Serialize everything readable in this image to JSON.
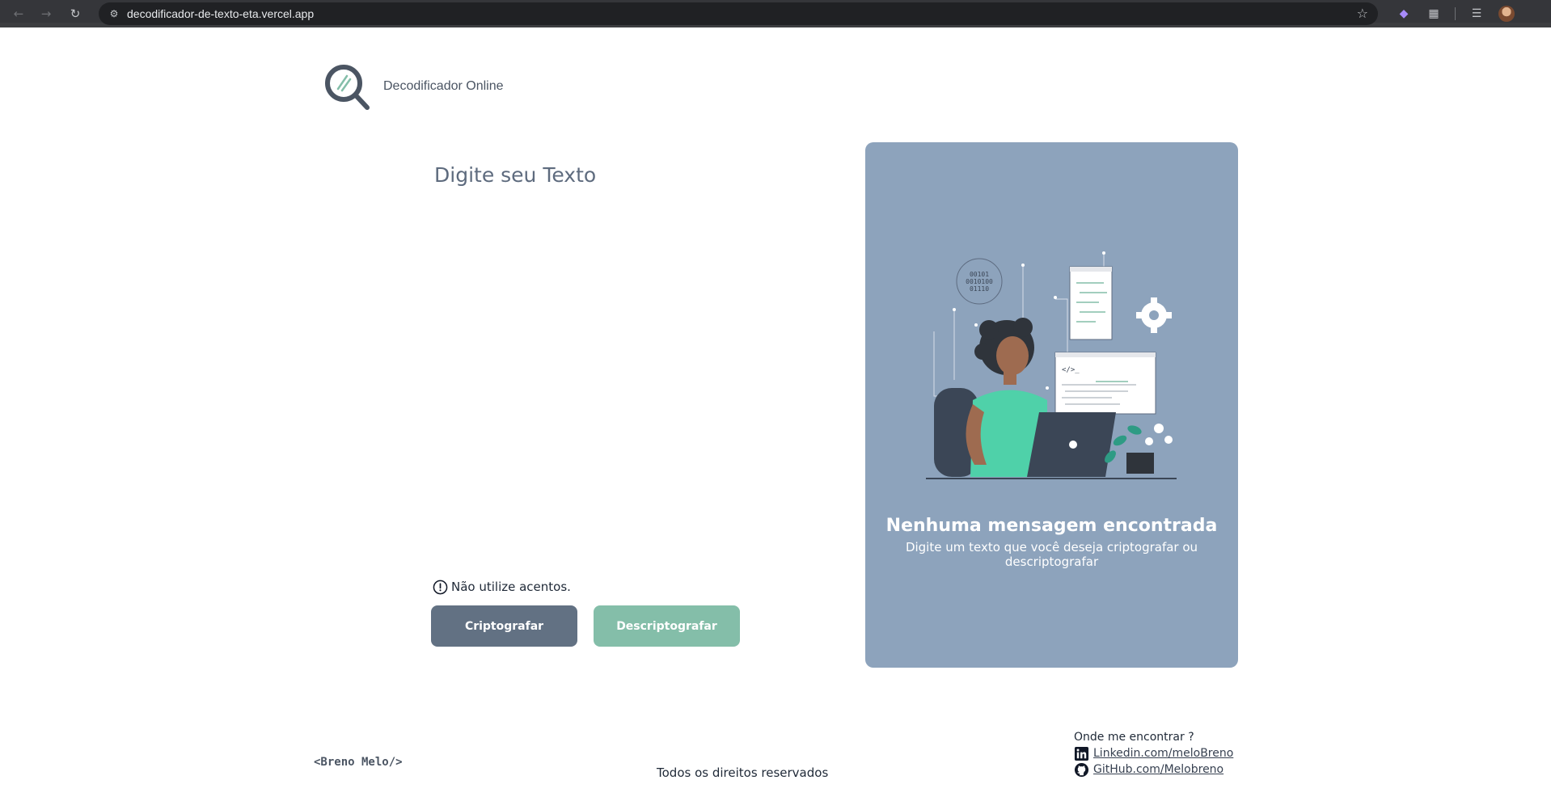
{
  "browser": {
    "url": "decodificador-de-texto-eta.vercel.app",
    "icons": {
      "back": "back-arrow-icon",
      "forward": "forward-arrow-icon",
      "reload": "reload-icon",
      "site_info": "tune-icon",
      "bookmark": "star-icon",
      "extensions": "puzzle-icon",
      "media": "playlist-icon",
      "profile": "avatar"
    }
  },
  "header": {
    "brand": "Decodificador Online",
    "logo": "magnifier-logo"
  },
  "main": {
    "input_placeholder": "Digite seu Texto",
    "hint": "Não utilize acentos.",
    "encrypt_label": "Criptografar",
    "decrypt_label": "Descriptografar"
  },
  "output": {
    "title": "Nenhuma mensagem encontrada",
    "subtitle": "Digite um texto que você deseja criptografar ou descriptografar",
    "illustration": "developer-at-laptop-illustration"
  },
  "footer": {
    "signature": "<Breno Melo/>",
    "rights": "Todos os direitos reservados",
    "contact_title": "Onde me encontrar ?",
    "linkedin": "Linkedin.com/meloBreno",
    "github": "GitHub.com/Melobreno"
  },
  "colors": {
    "encrypt_button": "#627183",
    "decrypt_button": "#84bea9",
    "panel": "#8da3bc",
    "heading": "#5e6b7e"
  }
}
